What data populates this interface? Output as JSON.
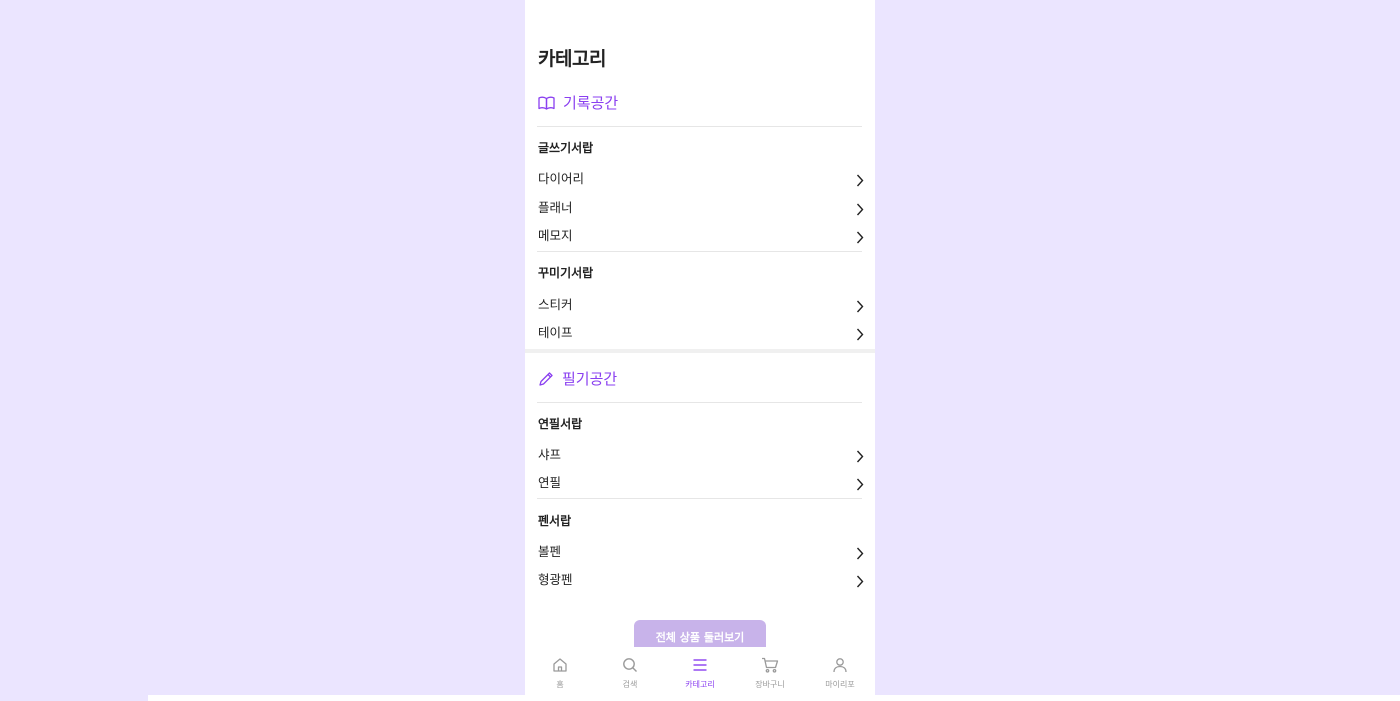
{
  "page_title": "카테고리",
  "sections": [
    {
      "title": "기록공간",
      "icon": "book-open-icon",
      "groups": [
        {
          "title": "글쓰기서랍",
          "items": [
            "다이어리",
            "플래너",
            "메모지"
          ]
        },
        {
          "title": "꾸미기서랍",
          "items": [
            "스티커",
            "테이프"
          ]
        }
      ]
    },
    {
      "title": "필기공간",
      "icon": "pencil-icon",
      "groups": [
        {
          "title": "연필서랍",
          "items": [
            "샤프",
            "연필"
          ]
        },
        {
          "title": "펜서랍",
          "items": [
            "볼펜",
            "형광펜"
          ]
        }
      ]
    }
  ],
  "cta_label": "전체 상품 둘러보기",
  "bottom_nav": [
    {
      "label": "홈",
      "icon": "home-icon",
      "active": false
    },
    {
      "label": "검색",
      "icon": "search-icon",
      "active": false
    },
    {
      "label": "카테고리",
      "icon": "menu-icon",
      "active": true
    },
    {
      "label": "장바구니",
      "icon": "cart-icon",
      "active": false
    },
    {
      "label": "마이리포",
      "icon": "user-icon",
      "active": false
    }
  ],
  "colors": {
    "accent": "#8a3ff0",
    "background": "#ebe5ff",
    "cta_background": "#c8b3ea",
    "inactive_nav": "#9a9a9a"
  }
}
